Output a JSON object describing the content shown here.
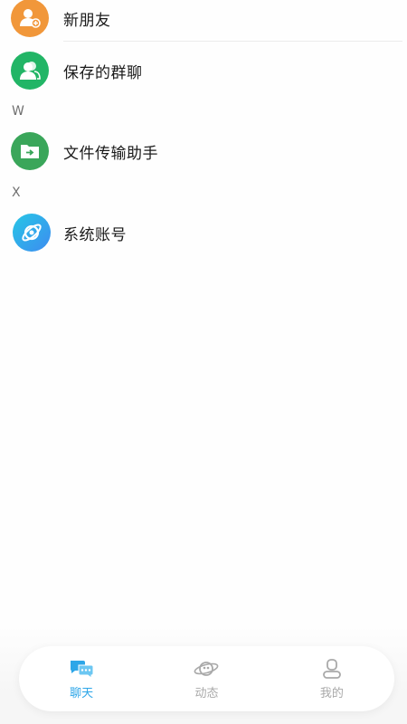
{
  "contacts": {
    "items": [
      {
        "label": "新朋友",
        "icon": "add-friend-icon",
        "color": "#f1973a"
      },
      {
        "label": "保存的群聊",
        "icon": "group-icon",
        "color": "#22b566"
      },
      {
        "label": "文件传输助手",
        "icon": "folder-transfer-icon",
        "color": "#3aa65a"
      },
      {
        "label": "系统账号",
        "icon": "planet-icon",
        "color": "#2fb4e8"
      }
    ],
    "sections": [
      {
        "letter": "W"
      },
      {
        "letter": "X"
      }
    ]
  },
  "tabbar": {
    "tabs": [
      {
        "label": "聊天",
        "icon": "chat-bubbles-icon",
        "active": true
      },
      {
        "label": "动态",
        "icon": "planet-outline-icon",
        "active": false
      },
      {
        "label": "我的",
        "icon": "person-outline-icon",
        "active": false
      }
    ]
  },
  "colors": {
    "accent": "#2da6e8",
    "inactive": "#a9a9a9"
  }
}
